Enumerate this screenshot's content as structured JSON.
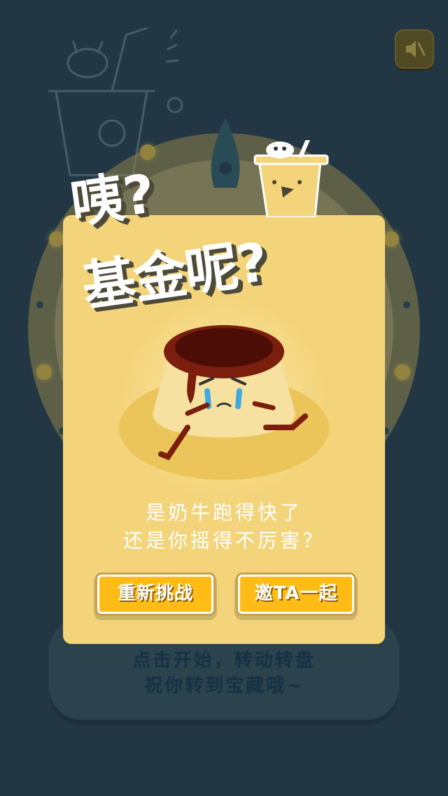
{
  "modal": {
    "title_line1": "咦?",
    "title_line2": "基金呢?",
    "message_line1": "是奶牛跑得快了",
    "message_line2": "还是你摇得不厉害？",
    "retry_label": "重新挑战",
    "invite_label": "邀TA一起"
  },
  "bottom_panel": {
    "line1": "点击开始，转动转盘",
    "line2": "祝你转到宝藏哦~"
  },
  "icons": {
    "mute": "sound-muted-icon"
  },
  "colors": {
    "background": "#2d4553",
    "modal": "#f3d47a",
    "button": "#ffbb16",
    "caramel": "#7b1e0d"
  }
}
